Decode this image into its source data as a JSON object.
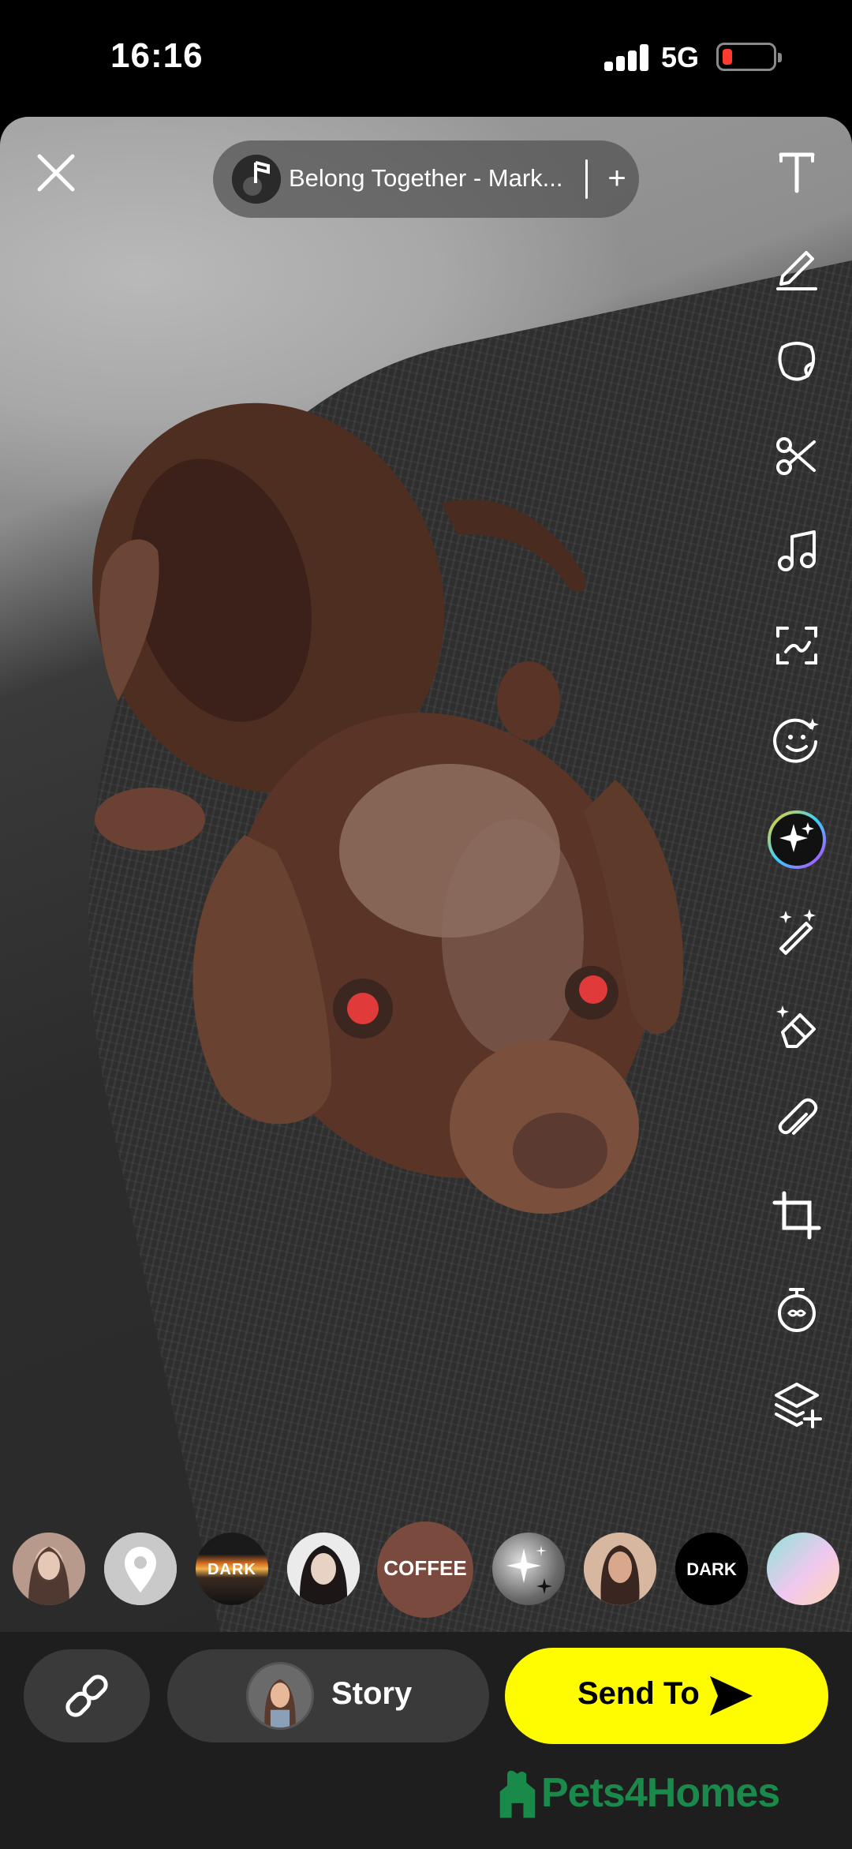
{
  "status_bar": {
    "time": "16:16",
    "network": "5G",
    "battery_color": "#ff3b30"
  },
  "music": {
    "track_label": "Belong Together - Mark...",
    "add_symbol": "+"
  },
  "toolbar": {
    "icons": [
      "text-icon",
      "pencil-icon",
      "sticker-icon",
      "scissors-icon",
      "music-note-icon",
      "scan-icon",
      "emoji-icon",
      "sparkle-ai-icon",
      "magic-wand-icon",
      "eraser-icon",
      "paperclip-icon",
      "crop-icon",
      "timer-icon",
      "layers-add-icon"
    ]
  },
  "story_bubbles": [
    {
      "name": "story-bubble-friend-1",
      "label": ""
    },
    {
      "name": "story-bubble-location",
      "label": ""
    },
    {
      "name": "story-bubble-dark-sunset",
      "label": "DARK"
    },
    {
      "name": "story-bubble-friend-2",
      "label": ""
    },
    {
      "name": "story-bubble-coffee",
      "label": "COFFEE"
    },
    {
      "name": "story-bubble-sparkles",
      "label": ""
    },
    {
      "name": "story-bubble-friend-3",
      "label": ""
    },
    {
      "name": "story-bubble-dark",
      "label": "DARK"
    },
    {
      "name": "story-bubble-gradient",
      "label": ""
    }
  ],
  "bottom_bar": {
    "story_label": "Story",
    "send_label": "Send To",
    "accent": "#fffc00"
  },
  "watermark": {
    "text": "Pets4Homes",
    "color": "#1a8a4a"
  }
}
